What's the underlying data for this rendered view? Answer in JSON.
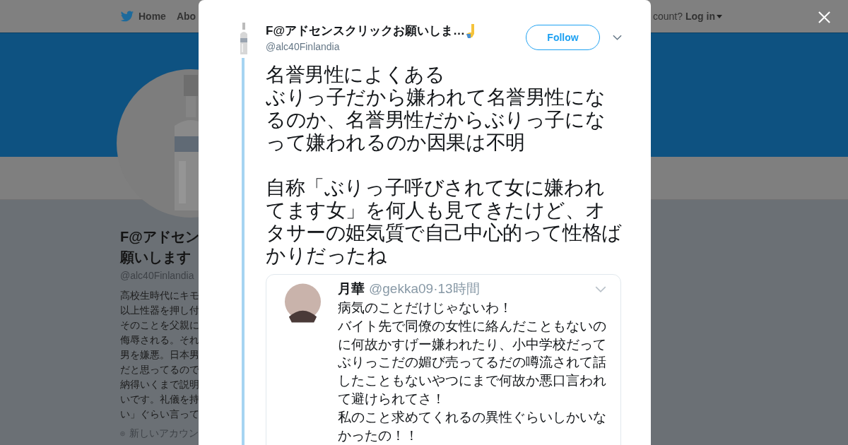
{
  "background_page": {
    "nav": [
      {
        "label": "Home"
      },
      {
        "label": "Abo"
      }
    ],
    "account_prompt": "count?",
    "login": "Log in",
    "profile": {
      "name_lines": [
        "F@アドセン",
        "願いします"
      ],
      "handle": "@alc40Finlandia",
      "bio_lines": [
        "高校生時代にキモ",
        "以上性器を押し付",
        "そのことを父親に",
        "侮辱される。それ",
        "男を嫌悪。日本男",
        "だと思ってるので",
        "納得いくまで説明",
        "いです。礼儀を持",
        "い」ぐらい言って"
      ],
      "location": "新しいアカウン"
    }
  },
  "tweet": {
    "author_name": "F@アドセンスクリックお願いしま…",
    "handle": "@alc40Finlandia",
    "follow_label": "Follow",
    "paragraphs": [
      [
        "名誉男性によくある",
        "ぶりっ子だから嫌われて名誉男性になるのか、名誉男性だからぶりっ子になって嫌われるのか因果は不明"
      ],
      [
        "自称「ぶりっ子呼びされて女に嫌われてます女」を何人も見てきたけど、オタサーの姫気質で自己中心的って性格ばかりだったね"
      ]
    ],
    "quoted_image": {
      "author_name": "月華",
      "handle": "@gekka09",
      "separator": "·",
      "time": "13時間",
      "lines": [
        "病気のことだけじゃないわ！",
        "バイト先で同僚の女性に絡んだこともないのに何故かすげー嫌われたり、小中学校だってぶりっこだの媚び売ってるだの噂流されて話したこともないやつにまで何故か悪口言われて避けられてさ！",
        "私のこと求めてくれるの異性ぐらいしかいなかったの！！"
      ]
    }
  }
}
